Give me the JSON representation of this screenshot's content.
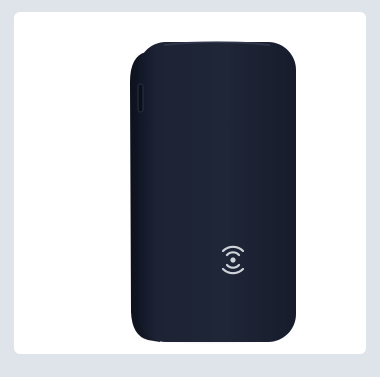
{
  "scene": {
    "subject_icon": "wireless-charging-icon",
    "colors": {
      "outer_background": "#dfe3ea",
      "card_background": "#ffffff",
      "device_body": "#1c2232",
      "device_edge": "#111626",
      "device_highlight": "#2d3447",
      "symbol": "#cfd3da"
    }
  }
}
